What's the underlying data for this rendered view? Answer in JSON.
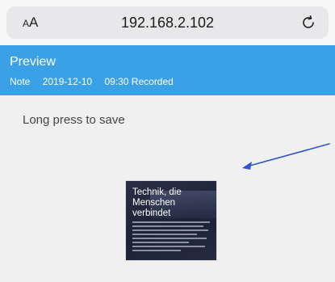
{
  "browser": {
    "text_size_label_small": "A",
    "text_size_label_large": "A",
    "url": "192.168.2.102"
  },
  "header": {
    "title": "Preview",
    "note_label": "Note",
    "date": "2019-12-10",
    "time_status": "09:30 Recorded"
  },
  "content": {
    "hint": "Long press to save",
    "image": {
      "heading_lines": [
        "Technik, die",
        "Menschen",
        "verbindet"
      ]
    }
  },
  "colors": {
    "header_bg": "#3aa1e6",
    "content_bg": "#f0f0f1",
    "arrow": "#2f55d4"
  },
  "icons": {
    "reload": "reload-icon",
    "arrow": "arrow-annotation"
  }
}
